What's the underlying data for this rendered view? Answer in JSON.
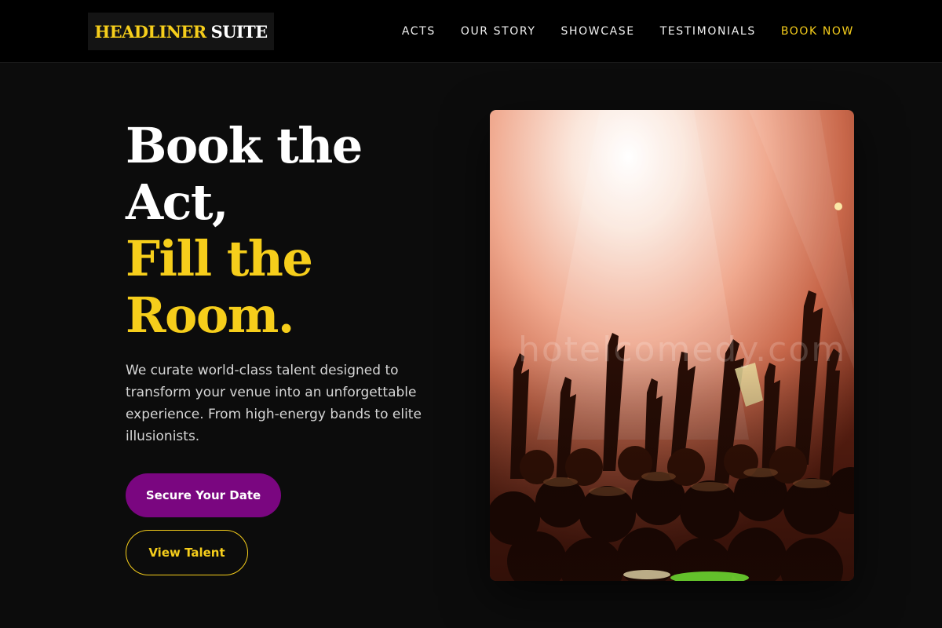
{
  "brand": {
    "name_accent": "HEADLINER",
    "name_rest": "SUITE"
  },
  "nav": {
    "items": [
      "ACTS",
      "OUR STORY",
      "SHOWCASE",
      "TESTIMONIALS"
    ],
    "cta": "BOOK NOW"
  },
  "hero": {
    "title_lines": [
      "Book the",
      "Act,"
    ],
    "highlight_lines": [
      "Fill the",
      "Room."
    ],
    "subtitle": "We curate world-class talent designed to transform your venue into an unforgettable experience. From high-energy bands to elite illusionists.",
    "primary_button": "Secure Your Date",
    "secondary_button": "View Talent"
  },
  "image": {
    "watermark": "hotelcomedy.com"
  },
  "colors": {
    "background": "#0c0c0c",
    "header": "#000000",
    "accent_yellow": "#f6ce1b",
    "primary_purple": "#7a0680"
  }
}
